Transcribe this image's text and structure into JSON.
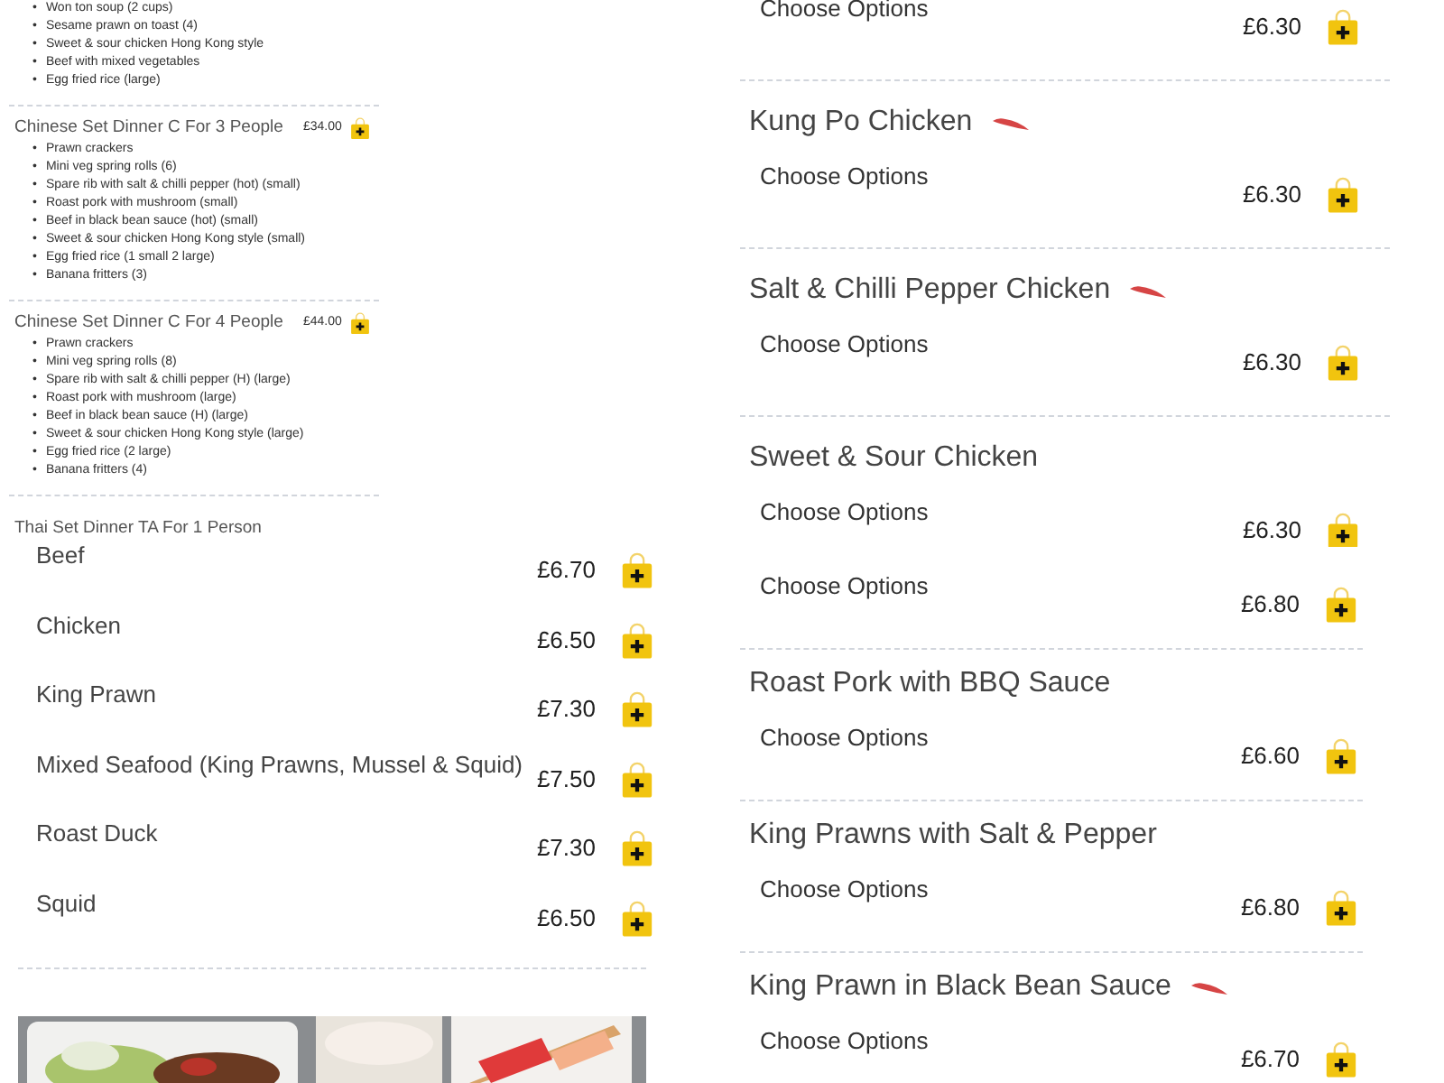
{
  "set_menu": {
    "bullet": "•",
    "top_items": [
      "Won ton soup (2 cups)",
      "Sesame prawn on toast (4)",
      "Sweet & sour chicken Hong Kong style",
      "Beef with mixed vegetables",
      "Egg fried rice (large)"
    ],
    "sets": [
      {
        "title": "Chinese Set Dinner C For 3 People",
        "price": "£34.00",
        "items": [
          "Prawn crackers",
          "Mini veg spring rolls (6)",
          "Spare rib with salt & chilli pepper (hot) (small)",
          "Roast pork with mushroom (small)",
          "Beef in black bean sauce (hot) (small)",
          "Sweet & sour chicken Hong Kong style (small)",
          "Egg fried rice (1 small 2 large)",
          "Banana fritters (3)"
        ]
      },
      {
        "title": "Chinese Set Dinner C For 4 People",
        "price": "£44.00",
        "items": [
          "Prawn crackers",
          "Mini veg spring rolls (8)",
          "Spare rib with salt & chilli pepper (H) (large)",
          "Roast pork with mushroom (large)",
          "Beef in black bean sauce (H) (large)",
          "Sweet & sour chicken Hong Kong style (large)",
          "Egg fried rice (2 large)",
          "Banana fritters (4)"
        ]
      }
    ],
    "cut_title": "Thai Set Dinner TA For 1 Person"
  },
  "options_list": [
    {
      "name": "Beef",
      "price": "£6.70"
    },
    {
      "name": "Chicken",
      "price": "£6.50"
    },
    {
      "name": "King Prawn",
      "price": "£7.30"
    },
    {
      "name": "Mixed Seafood (King Prawns, Mussel & Squid)",
      "price": "£7.50"
    },
    {
      "name": "Roast Duck",
      "price": "£7.30"
    },
    {
      "name": "Squid",
      "price": "£6.50"
    }
  ],
  "dishes_top": [
    {
      "options": "Choose Options",
      "price": "£6.30"
    },
    {
      "title": "Kung Po Chicken",
      "hot": true,
      "options": "Choose Options",
      "price": "£6.30"
    },
    {
      "title": "Salt & Chilli Pepper Chicken",
      "hot": true,
      "options": "Choose Options",
      "price": "£6.30"
    },
    {
      "title": "Sweet & Sour Chicken",
      "hot": false,
      "options": "Choose Options",
      "price": "£6.30"
    }
  ],
  "dishes_bottom": [
    {
      "options": "Choose Options",
      "price": "£6.80"
    },
    {
      "title": "Roast Pork with BBQ Sauce",
      "hot": false,
      "options": "Choose Options",
      "price": "£6.60"
    },
    {
      "title": "King Prawns with Salt & Pepper",
      "hot": false,
      "options": "Choose Options",
      "price": "£6.80"
    },
    {
      "title": "King Prawn in Black Bean Sauce",
      "hot": true,
      "options": "Choose Options",
      "price": "£6.70"
    }
  ]
}
